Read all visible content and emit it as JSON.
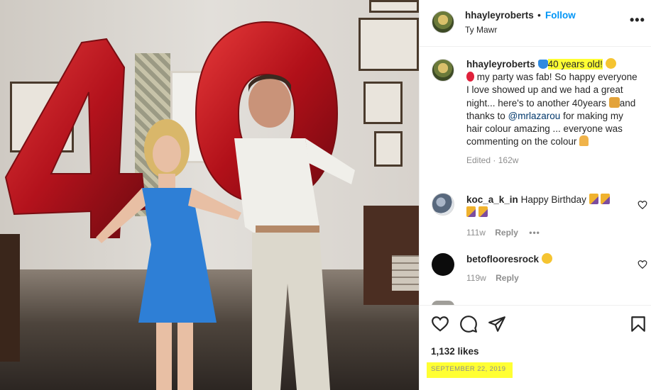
{
  "post": {
    "username": "hhayleyroberts",
    "follow_label": "Follow",
    "separator": "•",
    "location": "Ty Mawr",
    "more_label": "•••"
  },
  "caption": {
    "username": "hhayleyroberts",
    "highlight": "40 years old!",
    "text_line1": "my party was fab! So happy everyone I love showed up and we had a great night... here's to another 40years",
    "text_line2": "and thanks to",
    "mention": "@mrlazarou",
    "text_line3": "for making my hair colour amazing ... everyone was commenting on the colour",
    "edited": "Edited",
    "dot": "·",
    "age": "162w"
  },
  "comments": [
    {
      "username": "koc_a_k_in",
      "text": "Happy Birthday",
      "age": "111w",
      "reply": "Reply",
      "more": "•••"
    },
    {
      "username": "betoflooresrock",
      "text": "",
      "age": "119w",
      "reply": "Reply"
    }
  ],
  "footer": {
    "likes": "1,132 likes",
    "date": "SEPTEMBER 22, 2019"
  },
  "colors": {
    "link_blue": "#0095f6",
    "mention_blue": "#00376b",
    "highlight_yellow": "#ffff33",
    "balloon_red": "#c1121f"
  },
  "icons": [
    "heart-icon",
    "comment-icon",
    "share-icon",
    "bookmark-icon",
    "more-icon"
  ]
}
